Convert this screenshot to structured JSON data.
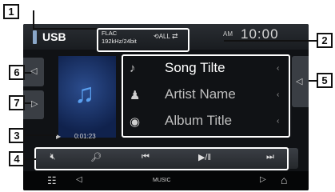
{
  "header": {
    "source": "USB",
    "format_line1": "FLAC",
    "format_line2": "192kHz/24bit",
    "repeat_icon": "repeat-all-icon",
    "shuffle_icon": "shuffle-icon",
    "clock_prefix": "AM",
    "clock_value": "10:00"
  },
  "track": {
    "song": "Song Tilte",
    "artist": "Artist Name",
    "album": "Album Title"
  },
  "playback": {
    "elapsed": "0:01:23"
  },
  "controls": [
    "mute-icon",
    "search-icon",
    "previous-icon",
    "play-pause-icon",
    "next-icon"
  ],
  "bottom": {
    "label": "MUSIC"
  },
  "callouts": [
    "1",
    "2",
    "3",
    "4",
    "5",
    "6",
    "7"
  ]
}
